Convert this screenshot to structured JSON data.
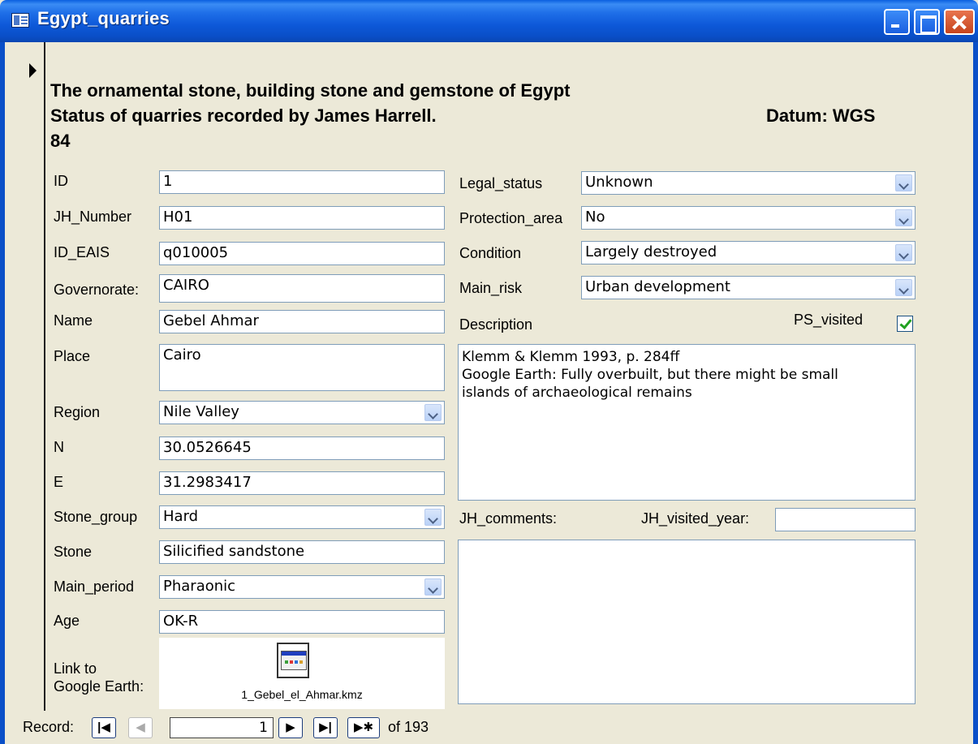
{
  "window": {
    "title": "Egypt_quarries"
  },
  "header": {
    "line1": "The ornamental stone, building stone and gemstone of Egypt",
    "line2": "Status of quarries recorded by James Harrell.",
    "datum": "Datum: WGS",
    "line3": "84"
  },
  "left_fields": {
    "id": {
      "label": "ID",
      "value": "1"
    },
    "jh_number": {
      "label": "JH_Number",
      "value": "H01"
    },
    "id_eais": {
      "label": "ID_EAIS",
      "value": "q010005"
    },
    "governorate": {
      "label": "Governorate:",
      "value": "CAIRO"
    },
    "name": {
      "label": "Name",
      "value": "Gebel Ahmar"
    },
    "place": {
      "label": "Place",
      "value": "Cairo"
    },
    "region": {
      "label": "Region",
      "value": "Nile Valley"
    },
    "n": {
      "label": "N",
      "value": "30.0526645"
    },
    "e": {
      "label": "E",
      "value": "31.2983417"
    },
    "stone_group": {
      "label": "Stone_group",
      "value": "Hard"
    },
    "stone": {
      "label": "Stone",
      "value": "Silicified sandstone"
    },
    "main_period": {
      "label": "Main_period",
      "value": "Pharaonic"
    },
    "age": {
      "label": "Age",
      "value": "OK-R"
    },
    "link": {
      "label_line1": "Link to",
      "label_line2": "Google Earth:",
      "file": "1_Gebel_el_Ahmar.kmz"
    }
  },
  "right_fields": {
    "legal_status": {
      "label": "Legal_status",
      "value": "Unknown"
    },
    "protection_area": {
      "label": "Protection_area",
      "value": "No"
    },
    "condition": {
      "label": "Condition",
      "value": "Largely destroyed"
    },
    "main_risk": {
      "label": "Main_risk",
      "value": "Urban development"
    },
    "description": {
      "label": "Description",
      "line1": "Klemm & Klemm 1993, p. 284ff",
      "line2": "Google Earth: Fully overbuilt, but there might be small",
      "line3": "islands of archaeological remains"
    },
    "ps_visited": {
      "label": "PS_visited",
      "checked": true
    },
    "jh_comments": {
      "label": "JH_comments:",
      "value": ""
    },
    "jh_visited_year": {
      "label": "JH_visited_year:",
      "value": ""
    }
  },
  "navigation": {
    "label": "Record:",
    "current": "1",
    "total_text": "of  193",
    "first_icon": "first-record-icon",
    "prev_icon": "prev-record-icon",
    "next_icon": "next-record-icon",
    "last_icon": "last-record-icon",
    "new_icon": "new-record-icon"
  },
  "colors": {
    "titlebar": "#0a4fc8",
    "form_bg": "#ece9d8",
    "field_border": "#7f9db9",
    "check": "#21a121"
  }
}
